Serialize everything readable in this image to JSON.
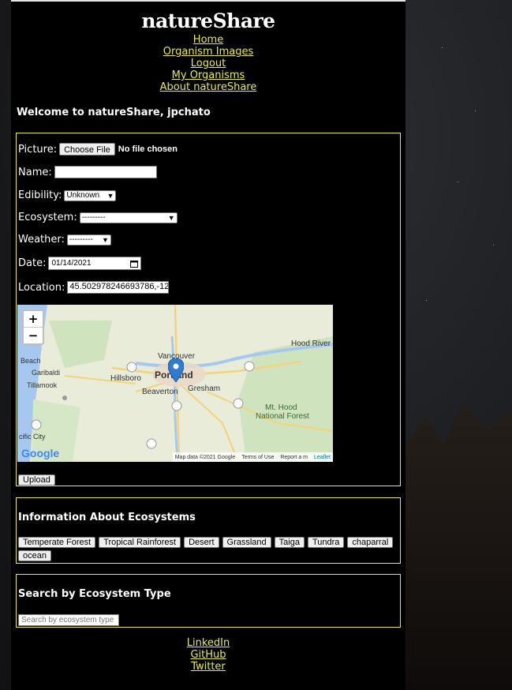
{
  "brand": "natureShare",
  "nav": [
    "Home",
    "Organism Images",
    "Logout",
    "My Organisms",
    "About natureShare"
  ],
  "welcome": "Welcome to natureShare, jpchato",
  "form": {
    "picture_label": "Picture:",
    "choose_file": "Choose File",
    "no_file": "No file chosen",
    "name_label": "Name:",
    "name_value": "",
    "edibility_label": "Edibility:",
    "edibility_value": "Unknown",
    "ecosystem_label": "Ecosystem:",
    "ecosystem_value": "---------",
    "weather_label": "Weather:",
    "weather_value": "---------",
    "date_label": "Date:",
    "date_value": "01/14/2021",
    "location_label": "Location:",
    "location_value": "45.502978246693786,-12",
    "upload_label": "Upload"
  },
  "map": {
    "zoom_in": "+",
    "zoom_out": "−",
    "places": [
      "Vancouver",
      "Portland",
      "Hillsboro",
      "Beaverton",
      "Gresham",
      "Hood River",
      "Mt. Hood",
      "National Forest",
      "Tillamook",
      "Garibaldi",
      "Beach",
      "cific City",
      "Google"
    ],
    "attribution_data": "Map data ©2021 Google",
    "attribution_terms": "Terms of Use",
    "attribution_report": "Report a m",
    "attribution_leaflet": "Leaflet",
    "colors": {
      "water": "#a6c8f0",
      "land": "#e8ecd9",
      "forest": "#cfe3bf",
      "road": "#f6d27b",
      "pin": "#2f7bd1"
    }
  },
  "ecosystems": {
    "title": "Information About Ecosystems",
    "items": [
      "Temperate Forest",
      "Tropical Rainforest",
      "Desert",
      "Grassland",
      "Taiga",
      "Tundra",
      "chaparral",
      "ocean"
    ]
  },
  "search": {
    "title": "Search by Ecosystem Type",
    "placeholder": "Search by ecosystem type"
  },
  "footer": [
    "LinkedIn",
    "GitHub",
    "Twitter"
  ],
  "colors": {
    "accent": "#e8e85a",
    "panel": "#000000"
  }
}
